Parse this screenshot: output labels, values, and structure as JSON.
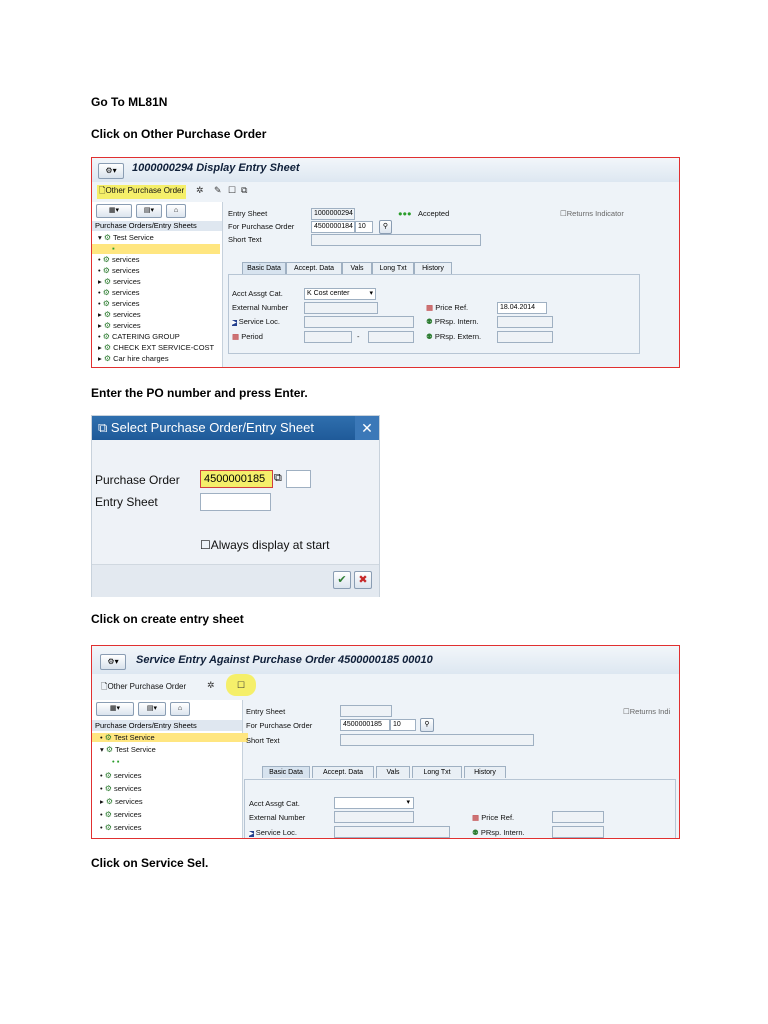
{
  "instructions": {
    "step1": "Go To ML81N",
    "step2": "Click on Other Purchase Order",
    "step3": "Enter the PO number and press Enter.",
    "step4": "Click on create entry sheet",
    "step5": "Click on Service Sel."
  },
  "shot1": {
    "title": "1000000294 Display Entry Sheet",
    "toolbar_other_po": "Other Purchase Order",
    "tree_header": "Purchase Orders/Entry Sheets",
    "tree_items": [
      "Test Service",
      "services",
      "services",
      "services",
      "services",
      "services",
      "services",
      "services",
      "CATERING GROUP",
      "CHECK EXT SERVICE-COST",
      "Car hire charges"
    ],
    "labels": {
      "entry_sheet": "Entry Sheet",
      "for_po": "For Purchase Order",
      "short_text": "Short Text",
      "acct_assgt": "Acct Assgt Cat.",
      "external_number": "External Number",
      "service_loc": "Service Loc.",
      "period": "Period",
      "price_ref": "Price Ref.",
      "prsp_intern": "PRsp. Intern.",
      "prsp_extern": "PRsp. Extern.",
      "returns": "Returns Indicator",
      "accepted": "Accepted",
      "dash": "-"
    },
    "values": {
      "entry_sheet": "1000000294",
      "po": "4500000184",
      "po_item": "10",
      "acct_assgt": "K Cost center",
      "price_ref": "18.04.2014"
    },
    "tabs": [
      "Basic Data",
      "Accept. Data",
      "Vals",
      "Long Txt",
      "History"
    ]
  },
  "dialog": {
    "title": "Select Purchase Order/Entry Sheet",
    "close": "✕",
    "po_label": "Purchase Order",
    "po_value": "4500000185",
    "entry_label": "Entry Sheet",
    "checkbox_label": "Always display at start",
    "ok": "✔",
    "cancel": "✖"
  },
  "shot2": {
    "title": "Service Entry Against Purchase Order 4500000185 00010",
    "toolbar_other_po": "Other Purchase Order",
    "tree_header": "Purchase Orders/Entry Sheets",
    "tree_items": [
      "Test Service",
      "Test Service",
      "services",
      "services",
      "services",
      "services",
      "services"
    ],
    "labels": {
      "entry_sheet": "Entry Sheet",
      "for_po": "For Purchase Order",
      "short_text": "Short Text",
      "acct_assgt": "Acct Assgt Cat.",
      "external_number": "External Number",
      "service_loc": "Service Loc.",
      "price_ref": "Price Ref.",
      "prsp_intern": "PRsp. Intern.",
      "returns": "Returns Indi"
    },
    "values": {
      "po": "4500000185",
      "po_item": "10"
    },
    "tabs": [
      "Basic Data",
      "Accept. Data",
      "Vals",
      "Long Txt",
      "History"
    ]
  },
  "colors": {
    "highlight": "#f5ef6a",
    "frame_border": "#e03030",
    "dialog_title": "#1f5a99"
  }
}
